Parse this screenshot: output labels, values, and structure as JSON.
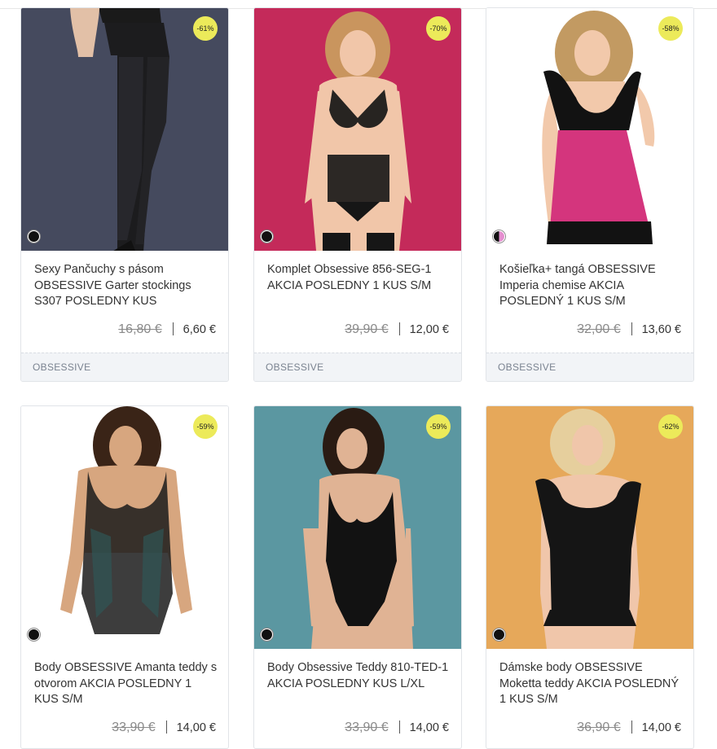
{
  "products": [
    {
      "title": "Sexy Pančuchy s pásom OBSESSIVE Garter stockings S307 POSLEDNY KUS",
      "old_price": "16,80 €",
      "new_price": "6,60 €",
      "discount": "-61%",
      "brand": "OBSESSIVE",
      "bg_color": "#454a5e",
      "swatch": "black"
    },
    {
      "title": "Komplet Obsessive 856-SEG-1 AKCIA POSLEDNY 1 KUS S/M",
      "old_price": "39,90 €",
      "new_price": "12,00 €",
      "discount": "-70%",
      "brand": "OBSESSIVE",
      "bg_color": "#c42a5a",
      "swatch": "black"
    },
    {
      "title": "Košieľka+ tangá OBSESSIVE Imperia chemise AKCIA POSLEDNÝ 1 KUS S/M",
      "old_price": "32,00 €",
      "new_price": "13,60 €",
      "discount": "-58%",
      "brand": "OBSESSIVE",
      "bg_color": "#ffffff",
      "swatch": "black-pink"
    },
    {
      "title": "Body OBSESSIVE Amanta teddy s otvorom AKCIA POSLEDNY 1 KUS S/M",
      "old_price": "33,90 €",
      "new_price": "14,00 €",
      "discount": "-59%",
      "brand": "",
      "bg_color": "#ffffff",
      "swatch": "black"
    },
    {
      "title": "Body Obsessive Teddy 810-TED-1 AKCIA POSLEDNY KUS L/XL",
      "old_price": "33,90 €",
      "new_price": "14,00 €",
      "discount": "-59%",
      "brand": "",
      "bg_color": "#5b97a1",
      "swatch": "black"
    },
    {
      "title": "Dámske body OBSESSIVE Moketta teddy AKCIA POSLEDNÝ 1 KUS S/M",
      "old_price": "36,90 €",
      "new_price": "14,00 €",
      "discount": "-62%",
      "brand": "",
      "bg_color": "#e6a85a",
      "swatch": "black"
    }
  ]
}
